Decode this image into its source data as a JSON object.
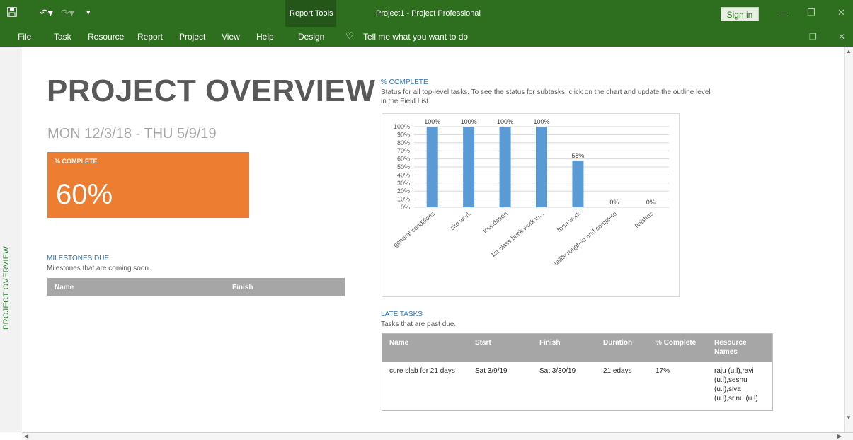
{
  "window": {
    "title": "Project1  -  Project Professional",
    "report_tools_label": "Report Tools",
    "sign_in_label": "Sign in"
  },
  "qat": {
    "save_icon": "save-icon",
    "undo_icon": "undo-icon",
    "redo_icon": "redo-icon",
    "customize_icon": "customize-qat-icon"
  },
  "menu": {
    "items": [
      "File",
      "Task",
      "Resource",
      "Report",
      "Project",
      "View",
      "Help"
    ],
    "design_tab": "Design",
    "tell_me": "Tell me what you want to do"
  },
  "side_label": "PROJECT OVERVIEW",
  "report": {
    "title": "PROJECT OVERVIEW",
    "date_range": "MON 12/3/18 -   THU 5/9/19",
    "kpi": {
      "label": "% COMPLETE",
      "value": "60%"
    },
    "milestones": {
      "title": "MILESTONES DUE",
      "description": "Milestones that are coming soon.",
      "columns": [
        "Name",
        "Finish"
      ]
    },
    "complete_section": {
      "title": "% COMPLETE",
      "description": "Status for all top-level tasks. To see the status for subtasks, click on the chart and update the outline level in the Field List."
    },
    "late_tasks": {
      "title": "LATE TASKS",
      "description": "Tasks that are past due.",
      "columns": [
        "Name",
        "Start",
        "Finish",
        "Duration",
        "% Complete",
        "Resource Names"
      ],
      "rows": [
        [
          "cure slab for 21 days",
          "Sat 3/9/19",
          "Sat 3/30/19",
          "21 edays",
          "17%",
          "raju (u.l),ravi (u.l),seshu (u.l),siva (u.l),srinu (u.l)"
        ]
      ]
    }
  },
  "chart_data": {
    "type": "bar",
    "categories": [
      "general conditions",
      "site work",
      "foundation",
      "1st class brick work in...",
      "form work",
      "utility rough-in and complete",
      "finishes"
    ],
    "values": [
      100,
      100,
      100,
      100,
      58,
      0,
      0
    ],
    "data_labels": [
      "100%",
      "100%",
      "100%",
      "100%",
      "58%",
      "0%",
      "0%"
    ],
    "y_ticks": [
      "0%",
      "10%",
      "20%",
      "30%",
      "40%",
      "50%",
      "60%",
      "70%",
      "80%",
      "90%",
      "100%"
    ],
    "ylim": [
      0,
      100
    ],
    "grid": true,
    "bar_color": "#5b9bd5"
  },
  "colors": {
    "ribbon": "#2e6f1f",
    "kpi": "#ed7d31",
    "section_title": "#2e75b6",
    "table_header": "#a6a6a6"
  }
}
